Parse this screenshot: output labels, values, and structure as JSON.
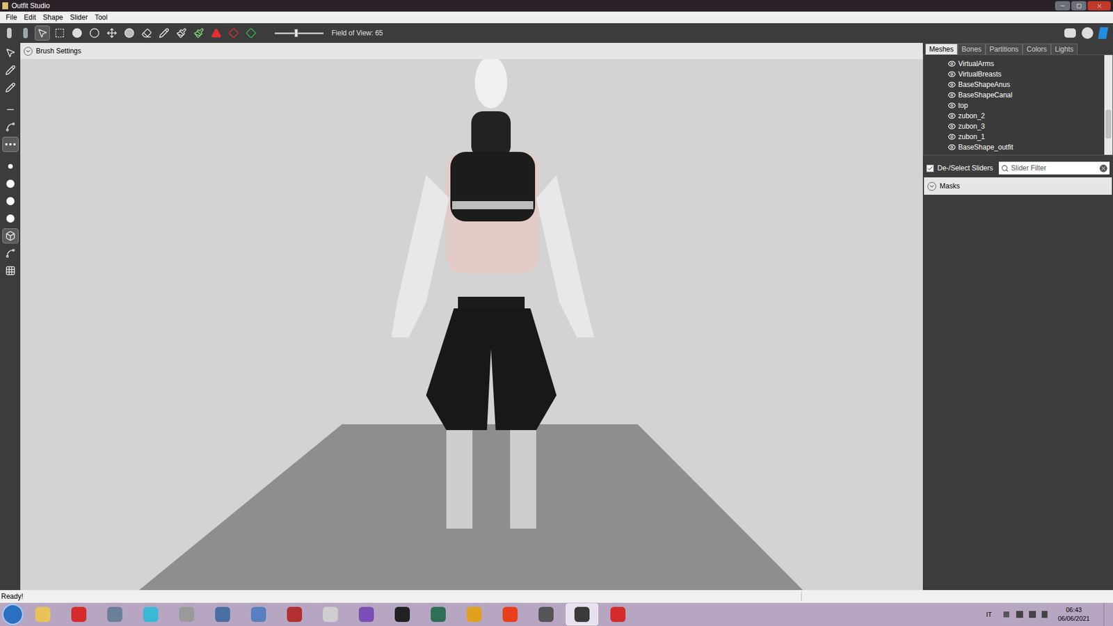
{
  "window": {
    "title": "Outfit Studio"
  },
  "menu": [
    "File",
    "Edit",
    "Shape",
    "Slider",
    "Tool"
  ],
  "toolbar": {
    "tools": [
      {
        "kind": "select",
        "selected": true
      },
      {
        "kind": "rect",
        "selected": false
      },
      {
        "kind": "inflate",
        "selected": false
      },
      {
        "kind": "deflate",
        "selected": false
      },
      {
        "kind": "move",
        "selected": false
      },
      {
        "kind": "smooth",
        "selected": false
      },
      {
        "kind": "erase",
        "selected": false
      },
      {
        "kind": "pencil",
        "selected": false
      },
      {
        "kind": "brush",
        "selected": false
      },
      {
        "kind": "paint",
        "selected": false
      },
      {
        "kind": "red",
        "selected": false
      },
      {
        "kind": "diamond",
        "selected": false
      },
      {
        "kind": "green",
        "selected": false
      }
    ],
    "fov_label": "Field of View: 65",
    "fov_level": 0.44
  },
  "left_tools": [
    {
      "kind": "pointer",
      "selected": false
    },
    {
      "kind": "pin",
      "selected": false
    },
    {
      "kind": "pencil",
      "selected": false
    },
    {
      "kind": "split",
      "selected": false
    },
    {
      "kind": "bone",
      "selected": false
    },
    {
      "kind": "dots",
      "selected": true
    },
    {
      "kind": "dot",
      "selected": false
    },
    {
      "kind": "circle",
      "selected": false
    },
    {
      "kind": "circle",
      "selected": false
    },
    {
      "kind": "circle",
      "selected": false
    },
    {
      "kind": "box",
      "selected": true
    },
    {
      "kind": "spline",
      "selected": false
    },
    {
      "kind": "grid",
      "selected": false
    }
  ],
  "brush_settings": {
    "label": "Brush Settings",
    "expanded": false
  },
  "panel_tabs": [
    {
      "label": "Meshes",
      "selected": true
    },
    {
      "label": "Bones",
      "selected": false
    },
    {
      "label": "Partitions",
      "selected": false
    },
    {
      "label": "Colors",
      "selected": false
    },
    {
      "label": "Lights",
      "selected": false
    }
  ],
  "meshes": [
    {
      "name": "VirtualArms",
      "visible": true
    },
    {
      "name": "VirtualBreasts",
      "visible": true
    },
    {
      "name": "BaseShapeAnus",
      "visible": true
    },
    {
      "name": "BaseShapeCanal",
      "visible": true
    },
    {
      "name": "top",
      "visible": true
    },
    {
      "name": "zubon_2",
      "visible": true
    },
    {
      "name": "zubon_3",
      "visible": true
    },
    {
      "name": "zubon_1",
      "visible": true
    },
    {
      "name": "BaseShape_outfit",
      "visible": true
    }
  ],
  "slider_select": {
    "label": "De-/Select Sliders",
    "checked": true
  },
  "slider_filter": {
    "placeholder": "Slider Filter"
  },
  "masks": {
    "label": "Masks",
    "expanded": false
  },
  "status": "Ready!",
  "taskbar": {
    "apps": [
      {
        "color": "#e8c35a",
        "selected": false
      },
      {
        "color": "#d42b2b",
        "selected": false
      },
      {
        "color": "#6b7f99",
        "selected": false
      },
      {
        "color": "#3bb7d8",
        "selected": false
      },
      {
        "color": "#9a9a9a",
        "selected": false
      },
      {
        "color": "#4a6fa5",
        "selected": false
      },
      {
        "color": "#5a7fc0",
        "selected": false
      },
      {
        "color": "#b23030",
        "selected": false
      },
      {
        "color": "#cfcfcf",
        "selected": false
      },
      {
        "color": "#7b4fb5",
        "selected": false
      },
      {
        "color": "#222222",
        "selected": false
      },
      {
        "color": "#2f6f55",
        "selected": false
      },
      {
        "color": "#e0a020",
        "selected": false
      },
      {
        "color": "#e8401c",
        "selected": false
      },
      {
        "color": "#555555",
        "selected": false
      },
      {
        "color": "#3a3a3a",
        "selected": true
      },
      {
        "color": "#d42b2b",
        "selected": false
      }
    ],
    "language": "IT",
    "time": "06:43",
    "date": "06/06/2021"
  }
}
